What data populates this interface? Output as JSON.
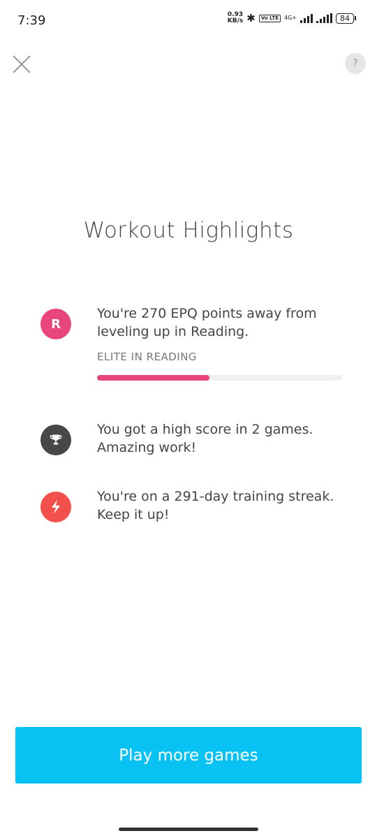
{
  "status_bar": {
    "time": "7:39",
    "speed_value": "0.93",
    "speed_unit": "KB/s",
    "volte": "Vo LTE",
    "network": "4G+",
    "battery": "84"
  },
  "header": {
    "close_icon": "close-icon",
    "help_label": "?"
  },
  "title": "Workout Highlights",
  "highlights": [
    {
      "icon": "R",
      "text": "You're 270 EPQ points away from leveling up in Reading.",
      "level_label": "ELITE IN READING",
      "progress": 0.46,
      "color": "#e8457a"
    },
    {
      "icon": "trophy-icon",
      "text": "You got a high score in 2 games. Amazing work!",
      "color": "#474747"
    },
    {
      "icon": "lightning-icon",
      "text": "You're on a 291-day training streak. Keep it up!",
      "color": "#f2504b"
    }
  ],
  "cta": {
    "label": "Play more games",
    "color": "#07c2f3"
  }
}
